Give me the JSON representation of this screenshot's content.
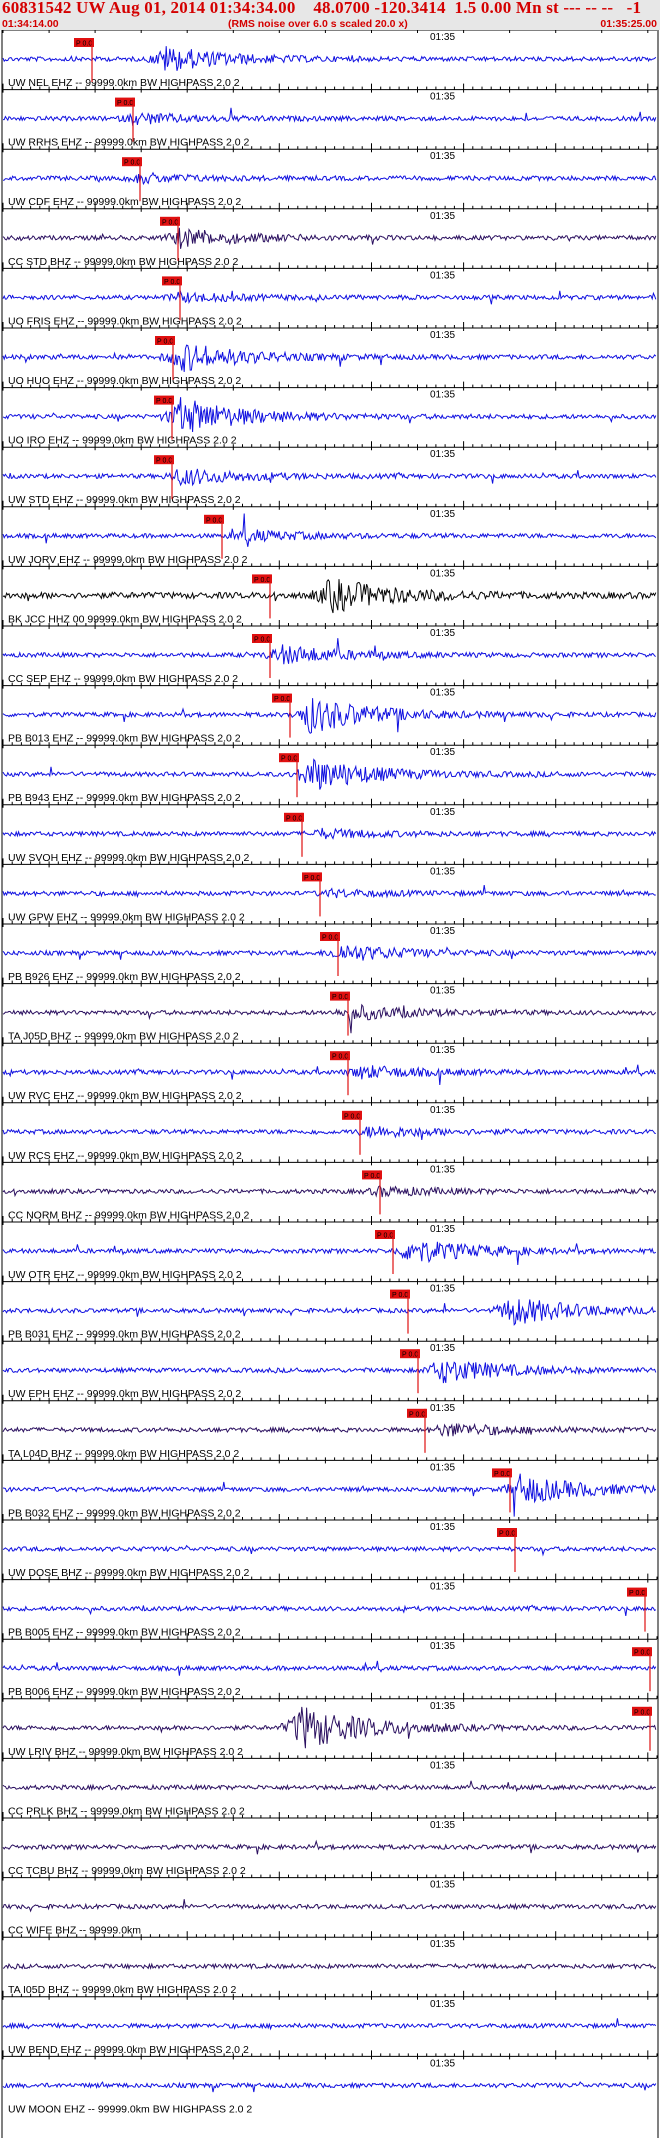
{
  "header": {
    "title": "60831542 UW Aug 01, 2014 01:34:34.00    48.0700 -120.3414  1.5 0.00 Mn st --- -- --   -1",
    "note": "(RMS noise over 6.0 s scaled 20.0 x)",
    "start_time": "01:34:14.00",
    "end_time": "01:35:25.00"
  },
  "marker_time_label": "01:35",
  "pick_label": "P 0.0",
  "colors": {
    "blue": "#1010e0",
    "black": "#050505",
    "purple": "#2b1060",
    "pick": "#e01010",
    "header_text": "#d40000",
    "header_bg": "#e7e7e7"
  },
  "traces": [
    {
      "label": "UW NEL EHZ -- 99999.0km BW  HIGHPASS  2.0  2",
      "color": "blue"
    },
    {
      "label": "UW RRHS EHZ -- 99999.0km BW  HIGHPASS  2.0  2",
      "color": "blue"
    },
    {
      "label": "UW CDF EHZ -- 99999.0km BW  HIGHPASS  2.0  2",
      "color": "blue"
    },
    {
      "label": "CC STD BHZ -- 99999.0km BW  HIGHPASS  2.0  2",
      "color": "purple"
    },
    {
      "label": "UO FRIS EHZ -- 99999.0km BW  HIGHPASS  2.0  2",
      "color": "blue"
    },
    {
      "label": "UO HUO EHZ -- 99999.0km BW  HIGHPASS  2.0  2",
      "color": "blue"
    },
    {
      "label": "UO IRO EHZ -- 99999.0km BW  HIGHPASS  2.0  2",
      "color": "blue"
    },
    {
      "label": "UW STD EHZ -- 99999.0km BW  HIGHPASS  2.0  2",
      "color": "blue"
    },
    {
      "label": "UW JORV EHZ -- 99999.0km BW  HIGHPASS  2.0  2",
      "color": "blue"
    },
    {
      "label": "BK JCC HHZ 00 99999.0km BW  HIGHPASS  2.0  2",
      "color": "black"
    },
    {
      "label": "CC SEP EHZ -- 99999.0km BW  HIGHPASS  2.0  2",
      "color": "blue"
    },
    {
      "label": "PB B013 EHZ -- 99999.0km BW  HIGHPASS  2.0  2",
      "color": "blue"
    },
    {
      "label": "PB B943 EHZ -- 99999.0km BW  HIGHPASS  2.0  2",
      "color": "blue"
    },
    {
      "label": "UW SVOH EHZ -- 99999.0km BW  HIGHPASS  2.0  2",
      "color": "blue"
    },
    {
      "label": "UW GPW EHZ -- 99999.0km BW  HIGHPASS  2.0  2",
      "color": "blue"
    },
    {
      "label": "PB B926 EHZ -- 99999.0km BW  HIGHPASS  2.0  2",
      "color": "blue"
    },
    {
      "label": "TA J05D BHZ -- 99999.0km BW  HIGHPASS  2.0  2",
      "color": "purple"
    },
    {
      "label": "UW RVC EHZ -- 99999.0km BW  HIGHPASS  2.0  2",
      "color": "blue"
    },
    {
      "label": "UW RCS EHZ -- 99999.0km BW  HIGHPASS  2.0  2",
      "color": "blue"
    },
    {
      "label": "CC NORM BHZ -- 99999.0km BW  HIGHPASS  2.0  2",
      "color": "purple"
    },
    {
      "label": "UW OTR EHZ -- 99999.0km BW  HIGHPASS  2.0  2",
      "color": "blue"
    },
    {
      "label": "PB B031 EHZ -- 99999.0km BW  HIGHPASS  2.0  2",
      "color": "blue"
    },
    {
      "label": "UW EPH EHZ -- 99999.0km BW  HIGHPASS  2.0  2",
      "color": "blue"
    },
    {
      "label": "TA L04D BHZ -- 99999.0km BW  HIGHPASS  2.0  2",
      "color": "purple"
    },
    {
      "label": "PB B032 EHZ -- 99999.0km BW  HIGHPASS  2.0  2",
      "color": "blue"
    },
    {
      "label": "UW DOSE BHZ -- 99999.0km BW  HIGHPASS  2.0  2",
      "color": "blue"
    },
    {
      "label": "PB B005 EHZ -- 99999.0km BW  HIGHPASS  2.0  2",
      "color": "blue"
    },
    {
      "label": "PB B006 EHZ -- 99999.0km BW  HIGHPASS  2.0  2",
      "color": "blue"
    },
    {
      "label": "UW LRIV BHZ -- 99999.0km BW  HIGHPASS  2.0  2",
      "color": "purple"
    },
    {
      "label": "CC PRLK BHZ -- 99999.0km BW  HIGHPASS  2.0  2",
      "color": "purple"
    },
    {
      "label": "CC TCBU BHZ -- 99999.0km BW  HIGHPASS  2.0  2",
      "color": "purple"
    },
    {
      "label": "CC WIFE BHZ -- 99999.0km",
      "color": "purple"
    },
    {
      "label": "TA I05D BHZ -- 99999.0km BW  HIGHPASS  2.0  2",
      "color": "purple"
    },
    {
      "label": "UW BEND EHZ -- 99999.0km BW  HIGHPASS  2.0  2",
      "color": "blue"
    },
    {
      "label": "UW MOON EHZ -- 99999.0km BW  HIGHPASS  2.0  2",
      "color": "blue"
    }
  ]
}
